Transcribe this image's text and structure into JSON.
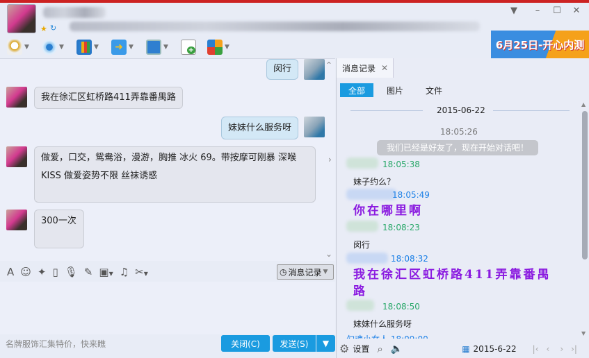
{
  "window": {
    "controls": [
      "menu",
      "minimize",
      "maximize",
      "close"
    ]
  },
  "toolbar": {
    "items": [
      "voice",
      "video",
      "screen-share",
      "file-transfer",
      "remote-desktop",
      "create-discussion",
      "apps"
    ]
  },
  "banner": {
    "text": "6月25日-开心内测"
  },
  "chat": {
    "messages": [
      {
        "from": "me",
        "text": "闵行"
      },
      {
        "from": "her",
        "text": "我在徐汇区虹桥路411弄靠番禺路"
      },
      {
        "from": "me",
        "text": "妹妹什么服务呀"
      },
      {
        "from": "her",
        "text": "做爱，口交，鸳鸯浴，漫游，胸推 冰火  69。带按摩可刚暴 深喉 KISS 做爱姿势不限 丝袜诱惑"
      },
      {
        "from": "her",
        "text": "300一次"
      }
    ]
  },
  "input": {
    "history_button": "消息记录",
    "ad_text": "名牌服饰汇集特价，快来瞧",
    "close_button": "关闭(C)",
    "send_button": "发送(S)"
  },
  "history": {
    "tab_label": "消息记录",
    "filters": [
      "全部",
      "图片",
      "文件"
    ],
    "date": "2015-06-22",
    "system_time": "18:05:26",
    "system_msg": "我们已经是好友了，现在开始对话吧！",
    "entries": [
      {
        "time": "18:05:38",
        "text": "妹子约么？",
        "style": "normal",
        "side": "me"
      },
      {
        "time": "18:05:49",
        "text": "你在哪里啊",
        "style": "fancy",
        "side": "her"
      },
      {
        "time": "18:08:23",
        "text": "闵行",
        "style": "normal",
        "side": "me"
      },
      {
        "time": "18:08:32",
        "text": "我在徐汇区虹桥路411弄靠番禺路",
        "style": "fancy",
        "side": "her"
      },
      {
        "time": "18:08:50",
        "text": "妹妹什么服务呀",
        "style": "normal",
        "side": "me"
      }
    ],
    "last_header": "勾魂小女人 18:09:00",
    "settings_label": "设置",
    "date_picker": "2015-6-22"
  },
  "colors": {
    "accent": "#1a9be0",
    "fancy_text": "#8a1ae0",
    "my_time": "#2aa86a",
    "her_time": "#1a7fe6"
  }
}
